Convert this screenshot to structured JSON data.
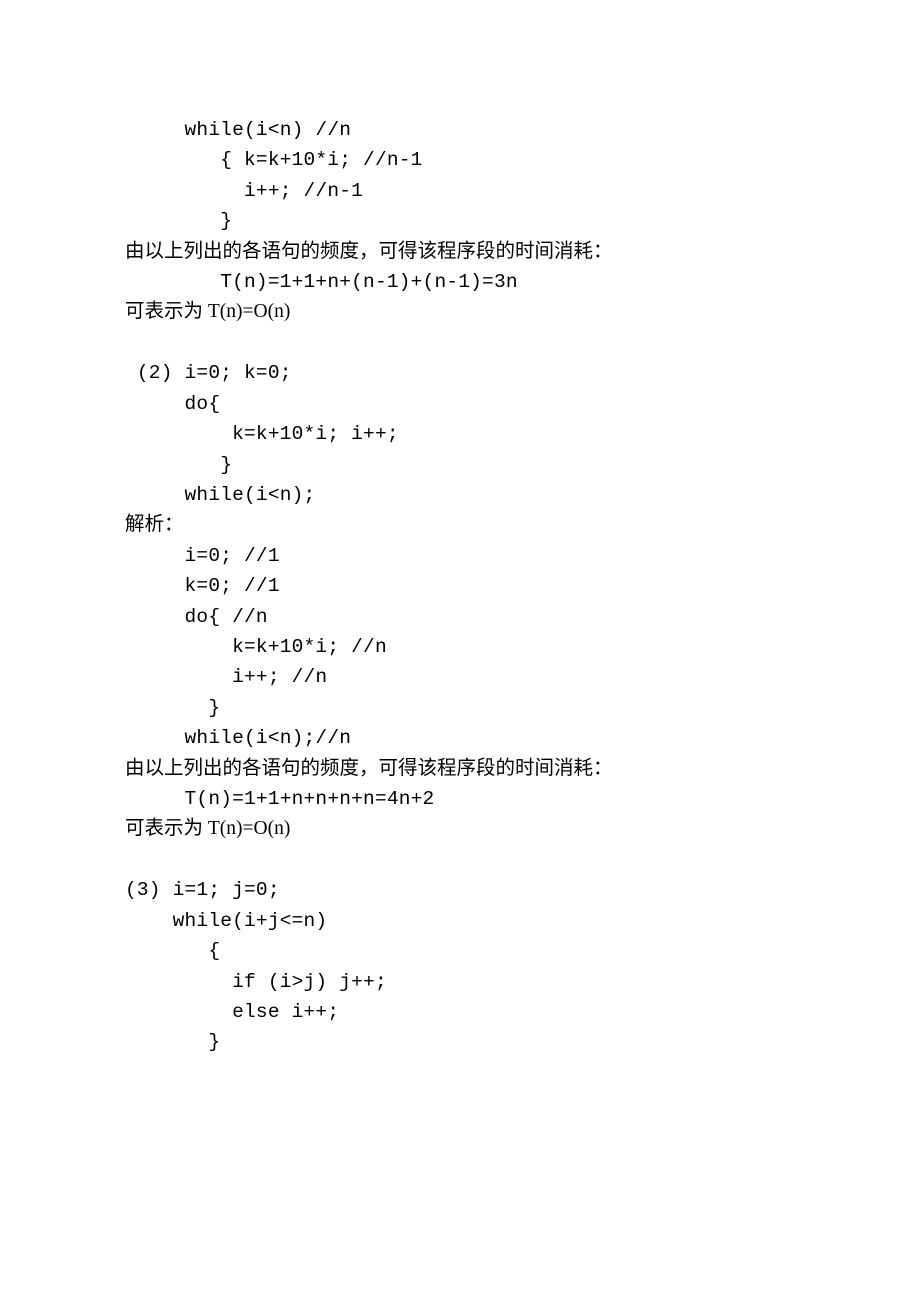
{
  "lines": [
    {
      "text": "     while(i<n) //n",
      "cls": "mono"
    },
    {
      "text": "        { k=k+10*i; //n-1",
      "cls": "mono"
    },
    {
      "text": "          i++; //n-1",
      "cls": "mono"
    },
    {
      "text": "        }",
      "cls": "mono"
    },
    {
      "text": "由以上列出的各语句的频度，可得该程序段的时间消耗：",
      "cls": ""
    },
    {
      "text": "        T(n)=1+1+n+(n-1)+(n-1)=3n",
      "cls": "mono"
    },
    {
      "text": "可表示为 T(n)=O(n)",
      "cls": ""
    },
    {
      "text": "",
      "cls": "blank"
    },
    {
      "text": " (2) i=0; k=0;",
      "cls": "mono"
    },
    {
      "text": "     do{",
      "cls": "mono"
    },
    {
      "text": "         k=k+10*i; i++;",
      "cls": "mono"
    },
    {
      "text": "        }",
      "cls": "mono"
    },
    {
      "text": "     while(i<n);",
      "cls": "mono"
    },
    {
      "text": "解析：",
      "cls": ""
    },
    {
      "text": "     i=0; //1",
      "cls": "mono"
    },
    {
      "text": "     k=0; //1",
      "cls": "mono"
    },
    {
      "text": "     do{ //n",
      "cls": "mono"
    },
    {
      "text": "         k=k+10*i; //n",
      "cls": "mono"
    },
    {
      "text": "         i++; //n",
      "cls": "mono"
    },
    {
      "text": "       }",
      "cls": "mono"
    },
    {
      "text": "     while(i<n);//n",
      "cls": "mono"
    },
    {
      "text": "由以上列出的各语句的频度，可得该程序段的时间消耗：",
      "cls": ""
    },
    {
      "text": "     T(n)=1+1+n+n+n+n=4n+2",
      "cls": "mono"
    },
    {
      "text": "可表示为 T(n)=O(n)",
      "cls": ""
    },
    {
      "text": "",
      "cls": "blank"
    },
    {
      "text": "(3) i=1; j=0;",
      "cls": "mono"
    },
    {
      "text": "    while(i+j<=n)",
      "cls": "mono"
    },
    {
      "text": "       {",
      "cls": "mono"
    },
    {
      "text": "         if (i>j) j++;",
      "cls": "mono"
    },
    {
      "text": "         else i++;",
      "cls": "mono"
    },
    {
      "text": "       }",
      "cls": "mono"
    }
  ]
}
